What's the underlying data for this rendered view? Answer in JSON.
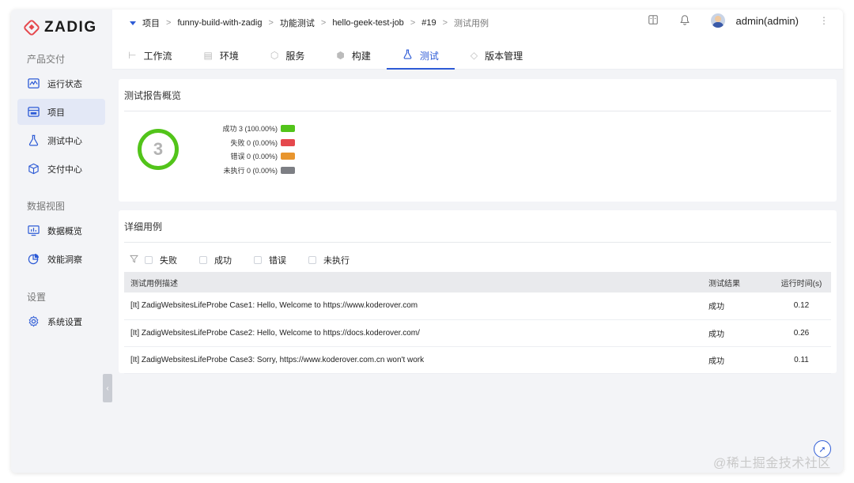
{
  "brand": {
    "name": "ZADIG"
  },
  "sidebar": {
    "groups": [
      {
        "label": "产品交付",
        "items": [
          {
            "label": "运行状态",
            "icon": "activity-icon"
          },
          {
            "label": "项目",
            "icon": "project-icon",
            "active": true
          },
          {
            "label": "测试中心",
            "icon": "flask-icon"
          },
          {
            "label": "交付中心",
            "icon": "package-icon"
          }
        ]
      },
      {
        "label": "数据视图",
        "items": [
          {
            "label": "数据概览",
            "icon": "dashboard-icon"
          },
          {
            "label": "效能洞察",
            "icon": "pie-chart-icon"
          }
        ]
      },
      {
        "label": "设置",
        "items": [
          {
            "label": "系统设置",
            "icon": "gear-icon"
          }
        ]
      }
    ]
  },
  "breadcrumb": [
    "项目",
    "funny-build-with-zadig",
    "功能测试",
    "hello-geek-test-job",
    "#19",
    "测试用例"
  ],
  "user": {
    "name": "admin(admin)"
  },
  "tabs": [
    {
      "label": "工作流",
      "icon": "workflow-icon"
    },
    {
      "label": "环境",
      "icon": "environment-icon"
    },
    {
      "label": "服务",
      "icon": "service-icon"
    },
    {
      "label": "构建",
      "icon": "build-icon"
    },
    {
      "label": "测试",
      "icon": "flask-icon",
      "active": true
    },
    {
      "label": "版本管理",
      "icon": "version-icon"
    }
  ],
  "overview": {
    "title": "测试报告概览",
    "total": "3",
    "legend": [
      {
        "label": "成功 3 (100.00%)",
        "color": "#52c41a"
      },
      {
        "label": "失败 0 (0.00%)",
        "color": "#e5484d"
      },
      {
        "label": "错误 0 (0.00%)",
        "color": "#e8952e"
      },
      {
        "label": "未执行 0 (0.00%)",
        "color": "#7d7f84"
      }
    ]
  },
  "details": {
    "title": "详细用例",
    "filters": [
      "失败",
      "成功",
      "错误",
      "未执行"
    ],
    "columns": [
      "测试用例描述",
      "测试结果",
      "运行时间(s)"
    ],
    "rows": [
      {
        "desc": "[It] ZadigWebsitesLifeProbe Case1: Hello, Welcome to https://www.koderover.com",
        "result": "成功",
        "time": "0.12"
      },
      {
        "desc": "[It] ZadigWebsitesLifeProbe Case2: Hello, Welcome to https://docs.koderover.com/",
        "result": "成功",
        "time": "0.26"
      },
      {
        "desc": "[It] ZadigWebsitesLifeProbe Case3: Sorry, https://www.koderover.com.cn won't work",
        "result": "成功",
        "time": "0.11"
      }
    ]
  },
  "watermark": "@稀土掘金技术社区"
}
